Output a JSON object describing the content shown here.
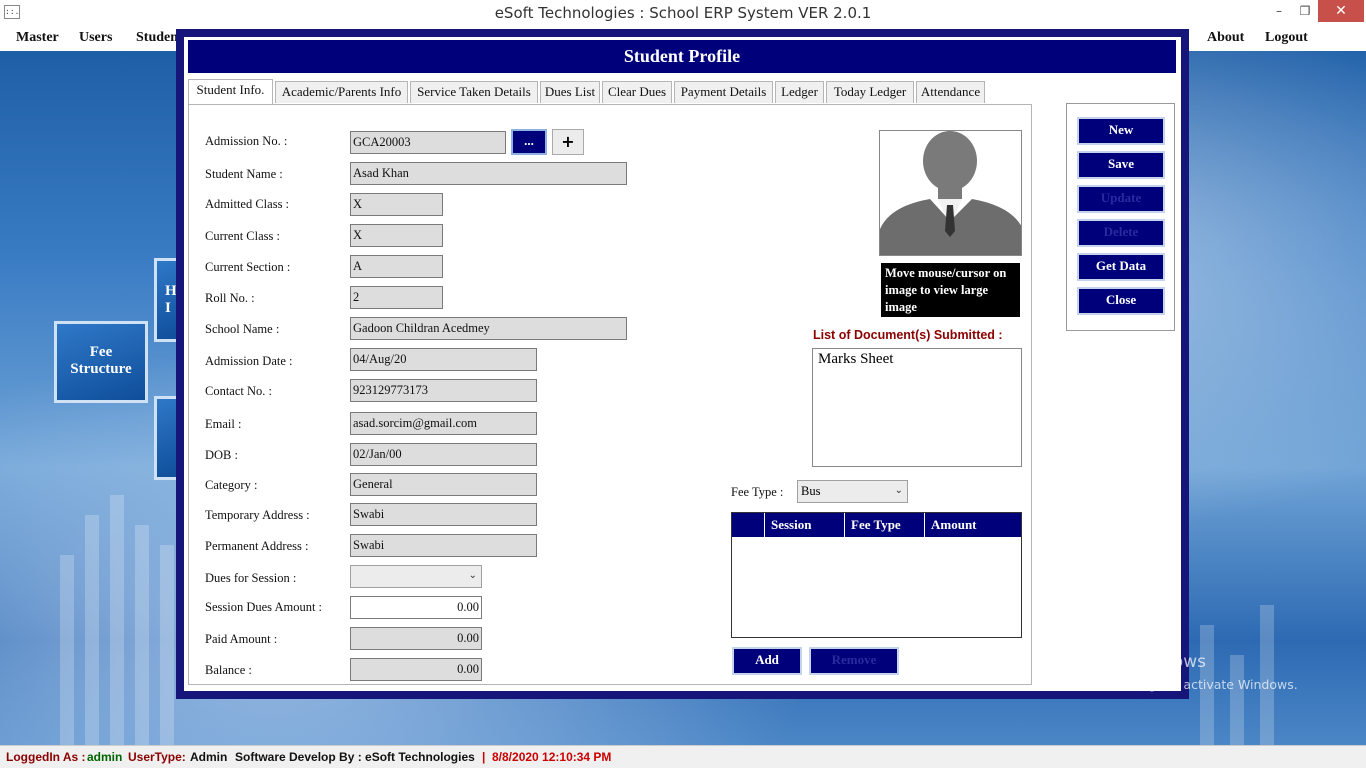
{
  "window": {
    "title": "eSoft Technologies : School ERP System VER 2.0.1",
    "app_icon_text": "::.",
    "min_glyph": "–",
    "max_glyph": "❐",
    "close_glyph": "✕"
  },
  "menu": {
    "master": "Master",
    "users": "Users",
    "students": "Studen",
    "about": "About",
    "logout": "Logout"
  },
  "desktop_tiles": {
    "fee_structure_line1": "Fee",
    "fee_structure_line2": "Structure",
    "partial_tile_text": "H",
    "partial_tile_text2": "I"
  },
  "form": {
    "header": "Student Profile",
    "tabs": [
      {
        "label": "Student Info."
      },
      {
        "label": "Academic/Parents Info"
      },
      {
        "label": "Service Taken Details"
      },
      {
        "label": "Dues List"
      },
      {
        "label": "Clear Dues"
      },
      {
        "label": "Payment Details"
      },
      {
        "label": "Ledger"
      },
      {
        "label": "Today Ledger"
      },
      {
        "label": "Attendance"
      }
    ],
    "fields": {
      "admission_no_label": "Admission No. :",
      "admission_no": "GCA20003",
      "lookup_button": "...",
      "add_button": "+",
      "student_name_label": "Student Name :",
      "student_name": "Asad Khan",
      "admitted_class_label": "Admitted Class :",
      "admitted_class": "X",
      "current_class_label": "Current Class :",
      "current_class": "X",
      "current_section_label": "Current Section :",
      "current_section": "A",
      "roll_no_label": "Roll No. :",
      "roll_no": "2",
      "school_name_label": "School Name :",
      "school_name": "Gadoon Childran Acedmey",
      "admission_date_label": "Admission Date :",
      "admission_date": "04/Aug/20",
      "contact_no_label": "Contact No. :",
      "contact_no": "923129773173",
      "email_label": "Email :",
      "email": "asad.sorcim@gmail.com",
      "dob_label": "DOB :",
      "dob": "02/Jan/00",
      "category_label": "Category :",
      "category": "General",
      "temp_address_label": "Temporary Address :",
      "temp_address": "Swabi",
      "perm_address_label": "Permanent Address :",
      "perm_address": "Swabi",
      "dues_session_label": "Dues for Session :",
      "dues_session": "",
      "session_dues_label": "Session Dues Amount :",
      "session_dues": "0.00",
      "paid_amount_label": "Paid Amount :",
      "paid_amount": "0.00",
      "balance_label": "Balance :",
      "balance": "0.00"
    },
    "photo_tip": "Move mouse/cursor on image to view large image",
    "docs_label": "List of Document(s) Submitted :",
    "docs": [
      "Marks Sheet"
    ],
    "fee_type_label": "Fee Type :",
    "fee_type": "Bus",
    "grid_headers": [
      "Session",
      "Fee Type",
      "Amount"
    ],
    "add_label": "Add",
    "remove_label": "Remove",
    "buttons": {
      "new": "New",
      "save": "Save",
      "update": "Update",
      "delete": "Delete",
      "get_data": "Get Data",
      "close": "Close"
    }
  },
  "status": {
    "logged_in_label": "LoggedIn As :",
    "user": "admin",
    "usertype_label": "UserType:",
    "usertype": "Admin",
    "developer": "Software Develop By : eSoft Technologies",
    "sep": "|",
    "datetime": "8/8/2020 12:10:34 PM"
  },
  "watermark": {
    "line1": "Activate Windows",
    "line2": "Go to PC settings to activate Windows."
  },
  "colors": {
    "form_navy": "#00007a",
    "doc_label": "#8b0000",
    "status_green": "#006400",
    "status_red": "#cc0000"
  }
}
